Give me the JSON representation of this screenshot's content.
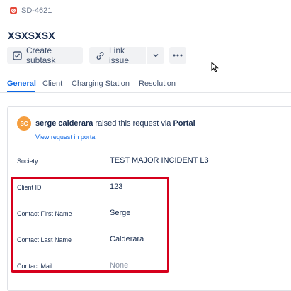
{
  "issue": {
    "key": "SD-4621",
    "title": "XSXSXSX"
  },
  "toolbar": {
    "create_subtask": "Create subtask",
    "link_issue": "Link issue"
  },
  "tabs": [
    {
      "label": "General",
      "active": true
    },
    {
      "label": "Client",
      "active": false
    },
    {
      "label": "Charging Station",
      "active": false
    },
    {
      "label": "Resolution",
      "active": false
    }
  ],
  "request": {
    "avatar_initials": "SC",
    "requester": "serge calderara",
    "raised_text": "raised this request via",
    "channel": "Portal",
    "view_link": "View request in portal"
  },
  "fields": [
    {
      "label": "Society",
      "value": "TEST MAJOR INCIDENT L3"
    },
    {
      "label": "Client ID",
      "value": "123"
    },
    {
      "label": "Contact First Name",
      "value": "Serge"
    },
    {
      "label": "Contact Last Name",
      "value": "Calderara"
    },
    {
      "label": "Contact Mail",
      "value": "None"
    }
  ],
  "colors": {
    "accent": "#0c66e4",
    "highlight_border": "#d6001c",
    "avatar": "#f59e3f",
    "issue_icon": "#e5493a"
  }
}
